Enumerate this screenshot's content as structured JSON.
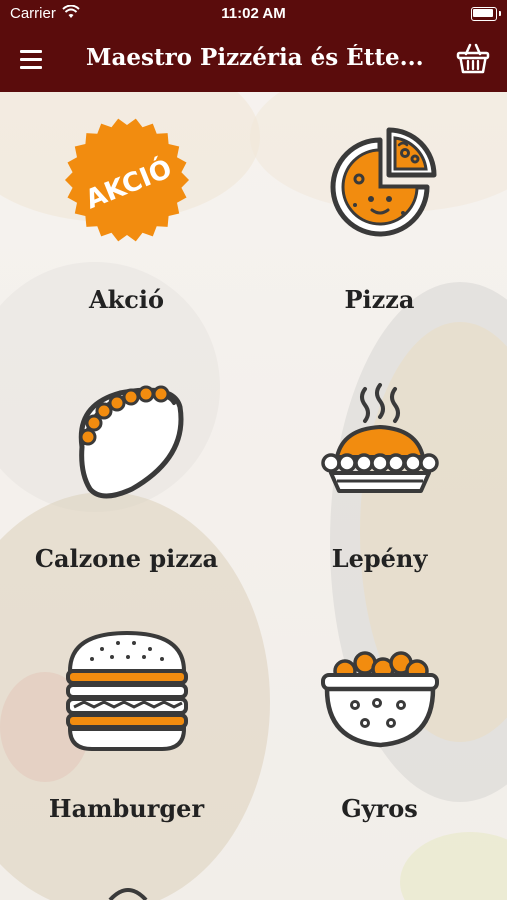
{
  "status_bar": {
    "carrier": "Carrier",
    "time": "11:02 AM"
  },
  "header": {
    "title": "Maestro Pizzéria és Étte...",
    "menu_icon": "hamburger-menu-icon",
    "cart_icon": "basket-icon"
  },
  "colors": {
    "header_bg": "#5a0c0c",
    "accent": "#f28c0f",
    "outline": "#3a3a3a"
  },
  "categories": [
    {
      "label": "Akció",
      "icon": "sale-badge-icon",
      "badge_text": "AKCIÓ"
    },
    {
      "label": "Pizza",
      "icon": "pizza-icon"
    },
    {
      "label": "Calzone pizza",
      "icon": "calzone-icon"
    },
    {
      "label": "Lepény",
      "icon": "pie-icon"
    },
    {
      "label": "Hamburger",
      "icon": "hamburger-icon"
    },
    {
      "label": "Gyros",
      "icon": "gyros-bowl-icon"
    }
  ]
}
